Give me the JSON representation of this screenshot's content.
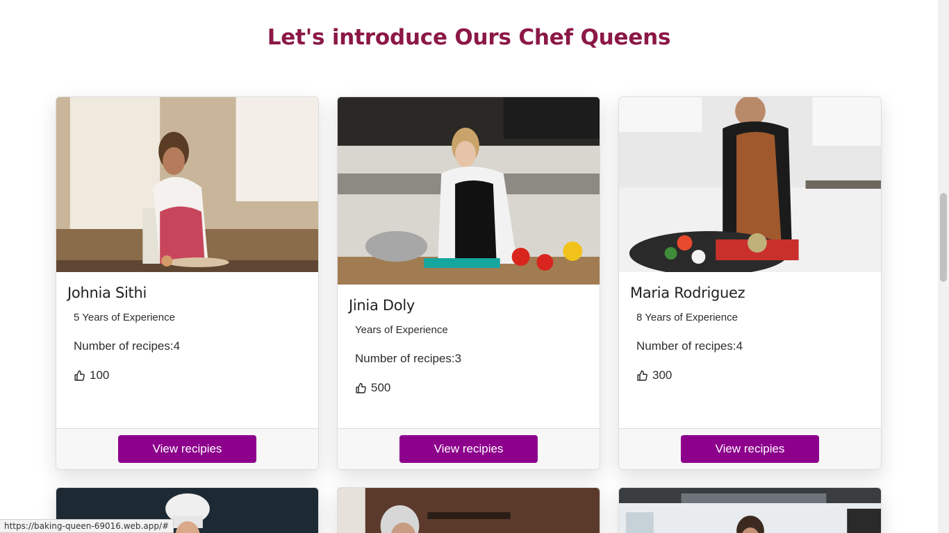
{
  "section": {
    "title": "Let's introduce Ours Chef Queens"
  },
  "chefs": [
    {
      "name": "Johnia Sithi",
      "experience": "5 Years of Experience",
      "recipes": "Number of recipes:4",
      "likes": "100",
      "button": "View recipies"
    },
    {
      "name": "Jinia Doly",
      "experience": "Years of Experience",
      "recipes": "Number of recipes:3",
      "likes": "500",
      "button": "View recipies"
    },
    {
      "name": "Maria Rodriguez",
      "experience": "8 Years of Experience",
      "recipes": "Number of recipes:4",
      "likes": "300",
      "button": "View recipies"
    }
  ],
  "colors": {
    "title": "#8b1846",
    "button": "#8c008c"
  },
  "icons": {
    "likes": "thumbs-up-icon"
  },
  "status_bar": {
    "url": "https://baking-queen-69016.web.app/#"
  }
}
